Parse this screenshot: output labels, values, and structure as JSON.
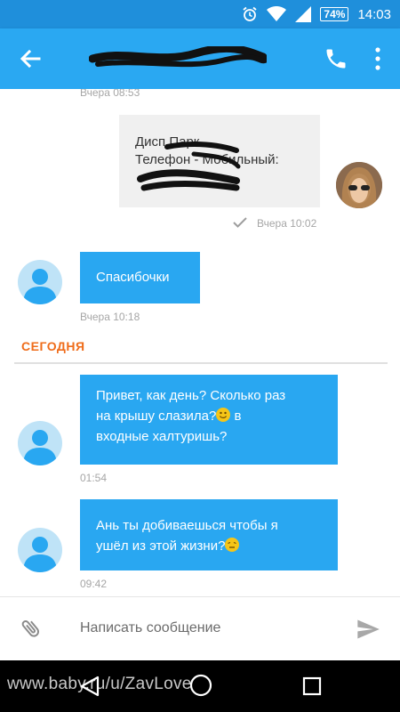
{
  "status_bar": {
    "battery": "74%",
    "time": "14:03",
    "icons": [
      "alarm-icon",
      "wifi-icon",
      "signal-icon",
      "battery-icon"
    ]
  },
  "app_bar": {
    "icons": [
      "back-arrow-icon",
      "phone-icon",
      "more-vert-icon"
    ]
  },
  "chat": {
    "top_timestamp": "Вчера 08:53",
    "outgoing_card": {
      "line1": "Дисп Парк",
      "line2": "Телефон - Мобильный:",
      "timestamp": "Вчера 10:02",
      "status_icon": "check-icon"
    },
    "messages": [
      {
        "text": "Спасибочки",
        "time": "Вчера 10:18"
      },
      {
        "text_a": "Привет, как день? Сколько раз",
        "text_b": "на крышу слазила?",
        "text_c": " в",
        "text_d": "входные халтуришь?",
        "time": "01:54"
      },
      {
        "text_a": "Ань ты добиваешься чтобы я",
        "text_b": "ушёл из этой жизни?",
        "time": "09:42"
      }
    ],
    "today_label": "СЕГОДНЯ"
  },
  "input_bar": {
    "placeholder": "Написать сообщение",
    "icons": [
      "attach-icon",
      "send-icon"
    ]
  },
  "nav_bar": {
    "icons": [
      "nav-back-icon",
      "nav-home-icon",
      "nav-recents-icon"
    ]
  },
  "watermark": "www.baby.ru/u/ZavLove",
  "colors": {
    "status_bar": "#1f8fdb",
    "app_bar": "#2aa8f2",
    "incoming_bubble": "#29a7f1",
    "today_label": "#ef6c1a",
    "outgoing_bubble": "#f0f0f0"
  }
}
